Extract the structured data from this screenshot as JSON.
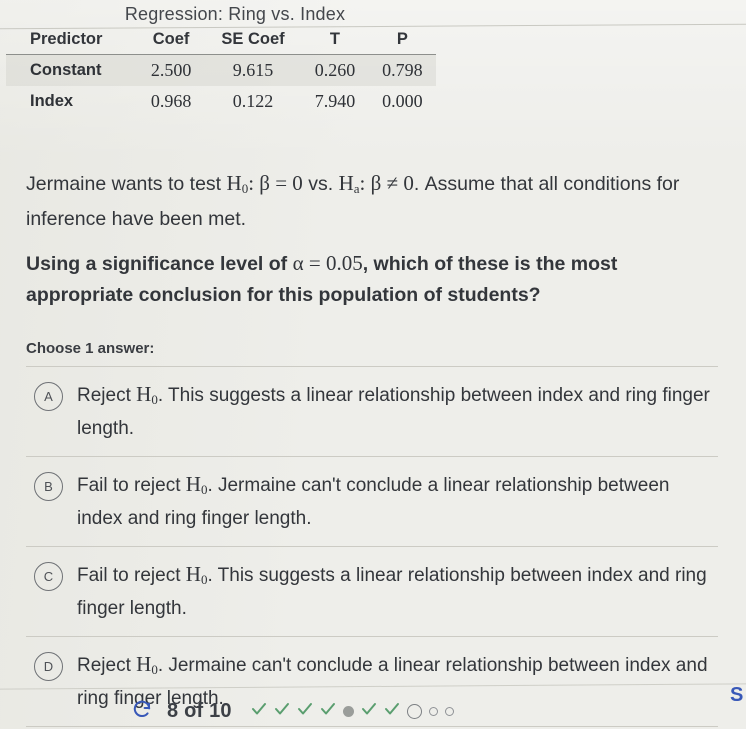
{
  "regression": {
    "title": "Regression: Ring vs. Index",
    "columns": [
      "Predictor",
      "Coef",
      "SE Coef",
      "T",
      "P"
    ],
    "rows": [
      {
        "predictor": "Constant",
        "coef": "2.500",
        "se_coef": "9.615",
        "t": "0.260",
        "p": "0.798"
      },
      {
        "predictor": "Index",
        "coef": "0.968",
        "se_coef": "0.122",
        "t": "7.940",
        "p": "0.000"
      }
    ]
  },
  "question": {
    "paragraph1_part1": "Jermaine wants to test ",
    "paragraph1_math1_h": "H",
    "paragraph1_math1_sub": "0",
    "paragraph1_math1_rest": ": β = 0",
    "paragraph1_mid": " vs. ",
    "paragraph1_math2_h": "H",
    "paragraph1_math2_sub": "a",
    "paragraph1_math2_rest": ": β ≠ 0",
    "paragraph1_part2": ". Assume that all conditions for inference have been met.",
    "paragraph2_part1": "Using a significance level of ",
    "paragraph2_math": "α = 0.05",
    "paragraph2_part2": ", which of these is the most appropriate conclusion for this population of students?"
  },
  "choices": {
    "instruction": "Choose 1 answer:",
    "options": [
      {
        "letter": "A",
        "text_pre": "Reject ",
        "math_h": "H",
        "math_sub": "0",
        "text_post": ". This suggests a linear relationship between index and ring finger length."
      },
      {
        "letter": "B",
        "text_pre": "Fail to reject ",
        "math_h": "H",
        "math_sub": "0",
        "text_post": ". Jermaine can't conclude a linear relationship between index and ring finger length."
      },
      {
        "letter": "C",
        "text_pre": "Fail to reject ",
        "math_h": "H",
        "math_sub": "0",
        "text_post": ". This suggests a linear relationship between index and ring finger length."
      },
      {
        "letter": "D",
        "text_pre": "Reject ",
        "math_h": "H",
        "math_sub": "0",
        "text_post": ". Jermaine can't conclude a linear relationship between index and ring finger length."
      }
    ]
  },
  "footer": {
    "retry_icon": "refresh-icon",
    "progress_label": "8 of 10",
    "progress_dots": [
      "check",
      "check",
      "check",
      "check",
      "filled",
      "check",
      "check",
      "current",
      "empty",
      "empty"
    ],
    "submit_label": "S"
  },
  "colors": {
    "background": "#eeeeea",
    "text": "#33363b",
    "check_green": "#5a9e6f",
    "accent_blue": "#3858b8",
    "divider": "#cccbc4"
  }
}
